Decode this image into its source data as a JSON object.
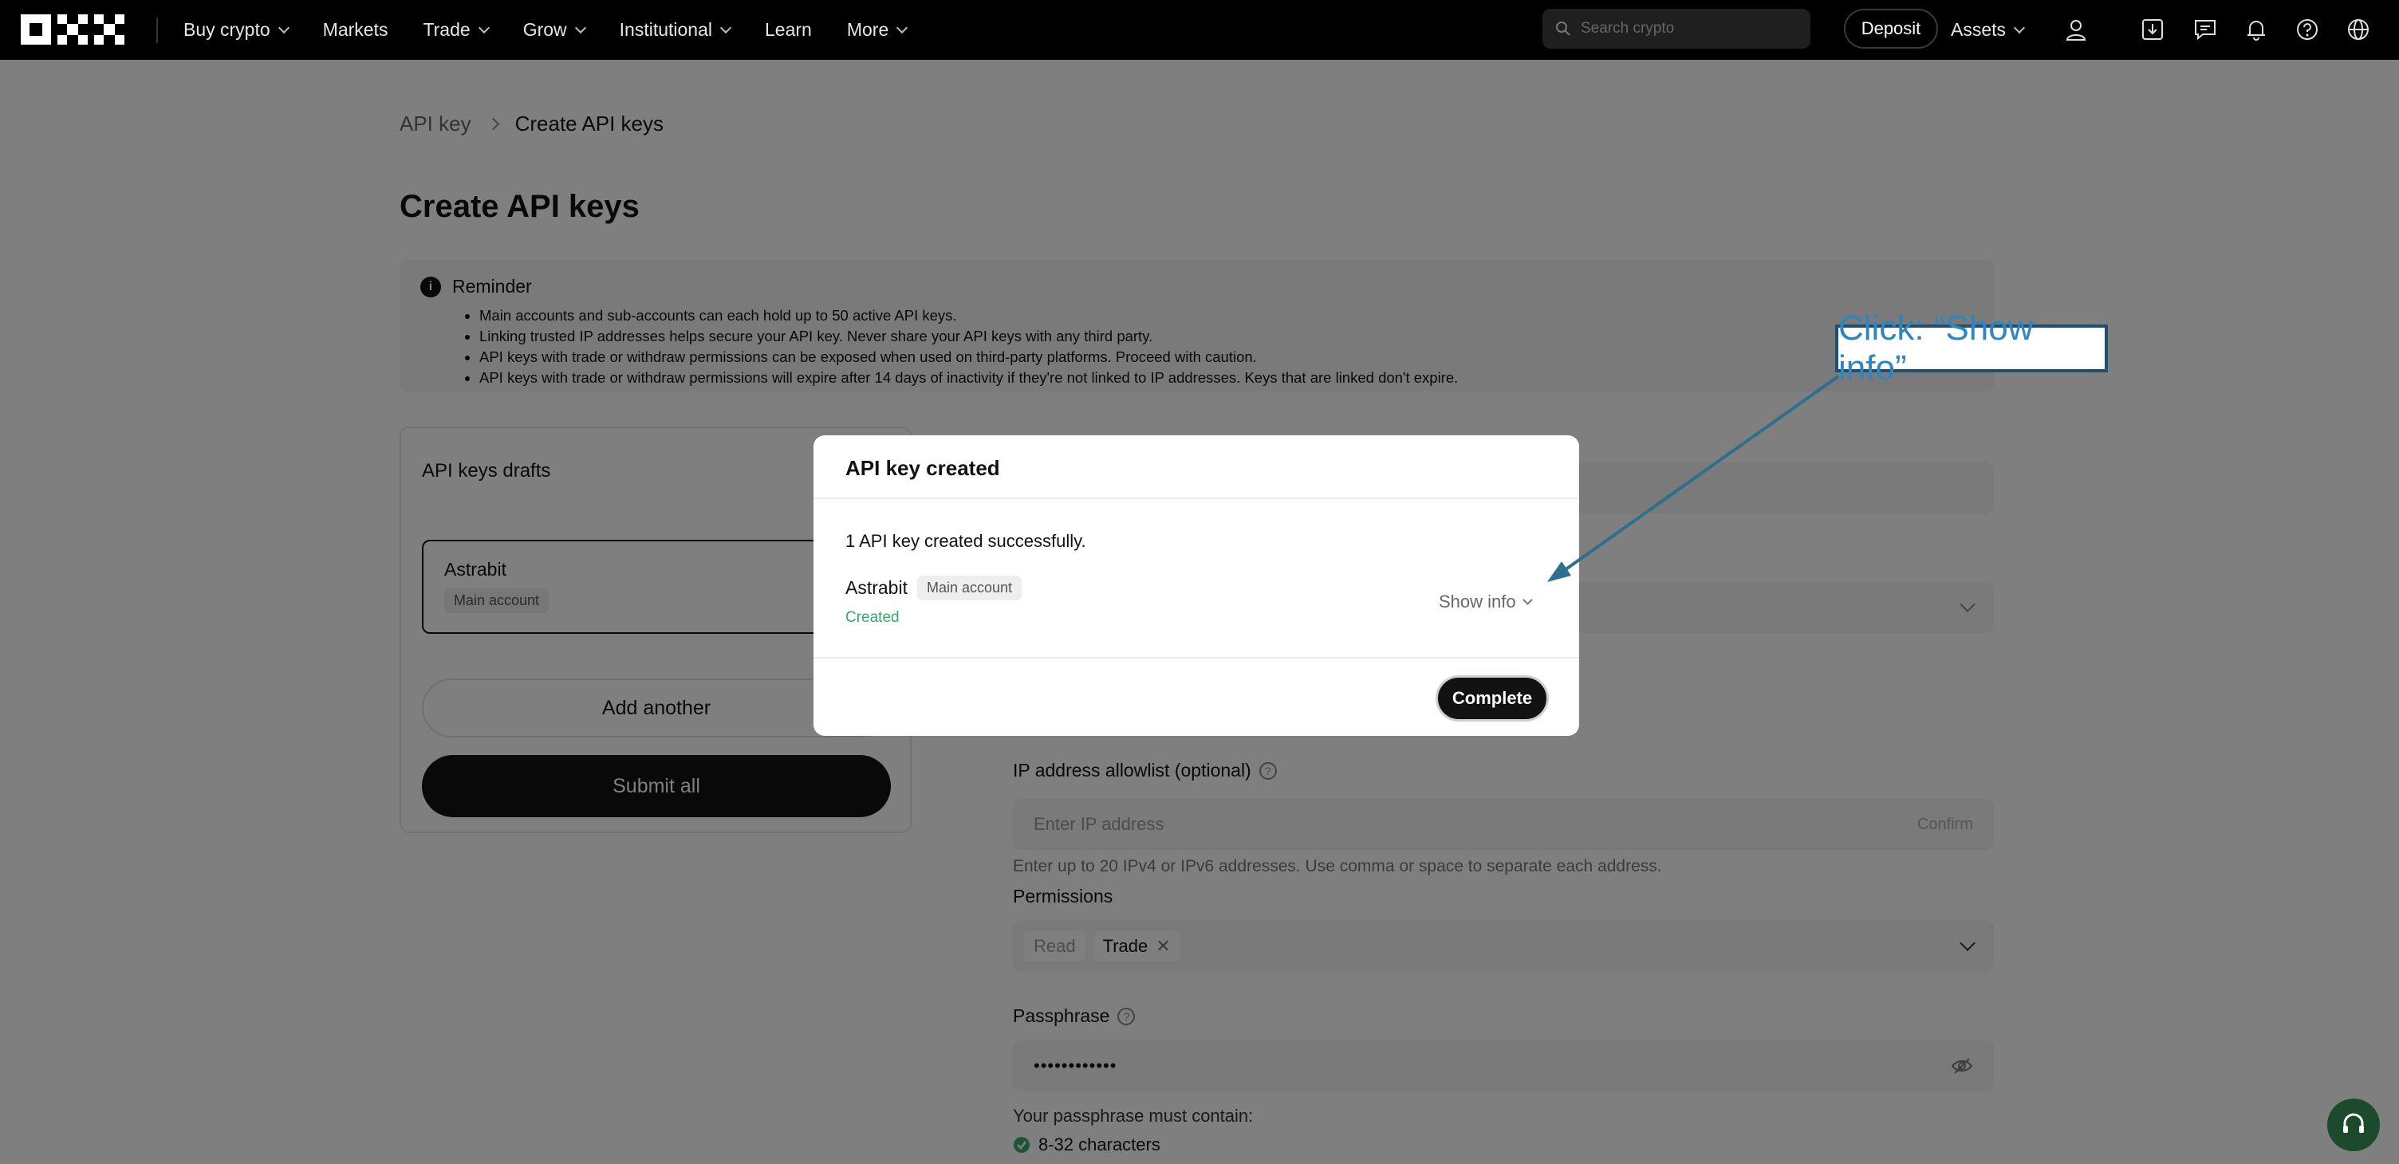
{
  "nav": {
    "items": [
      {
        "label": "Buy crypto",
        "dropdown": true
      },
      {
        "label": "Markets",
        "dropdown": false
      },
      {
        "label": "Trade",
        "dropdown": true
      },
      {
        "label": "Grow",
        "dropdown": true
      },
      {
        "label": "Institutional",
        "dropdown": true
      },
      {
        "label": "Learn",
        "dropdown": false
      },
      {
        "label": "More",
        "dropdown": true
      }
    ],
    "search_placeholder": "Search crypto",
    "deposit_label": "Deposit",
    "assets_label": "Assets"
  },
  "breadcrumb": {
    "parent": "API key",
    "current": "Create API keys"
  },
  "page_title": "Create API keys",
  "reminder": {
    "title": "Reminder",
    "items": [
      "Main accounts and sub-accounts can each hold up to 50 active API keys.",
      "Linking trusted IP addresses helps secure your API key. Never share your API keys with any third party.",
      "API keys with trade or withdraw permissions can be exposed when used on third-party platforms. Proceed with caution.",
      "API keys with trade or withdraw permissions will expire after 14 days of inactivity if they're not linked to IP addresses. Keys that are linked don't expire."
    ]
  },
  "drafts": {
    "title": "API keys drafts",
    "item": {
      "name": "Astrabit",
      "account": "Main account"
    },
    "add_label": "Add another",
    "submit_label": "Submit all"
  },
  "form": {
    "ip_label": "IP address allowlist (optional)",
    "ip_placeholder": "Enter IP address",
    "ip_confirm": "Confirm",
    "ip_hint": "Enter up to 20 IPv4 or IPv6 addresses. Use comma or space to separate each address.",
    "permissions_label": "Permissions",
    "permissions": [
      "Read",
      "Trade"
    ],
    "passphrase_label": "Passphrase",
    "passphrase_value": "••••••••••••",
    "passphrase_rules_title": "Your passphrase must contain:",
    "passphrase_rule_1": "8-32 characters"
  },
  "modal": {
    "title": "API key created",
    "success_text": "1 API key created successfully.",
    "key_name": "Astrabit",
    "key_account": "Main account",
    "status": "Created",
    "show_info_label": "Show info",
    "complete_label": "Complete"
  },
  "annotation": {
    "text": "Click: “Show info”"
  },
  "colors": {
    "success": "#3aa76d",
    "annotation_text": "#2e86c1",
    "annotation_border": "#1f4e79",
    "primary": "#121212"
  }
}
